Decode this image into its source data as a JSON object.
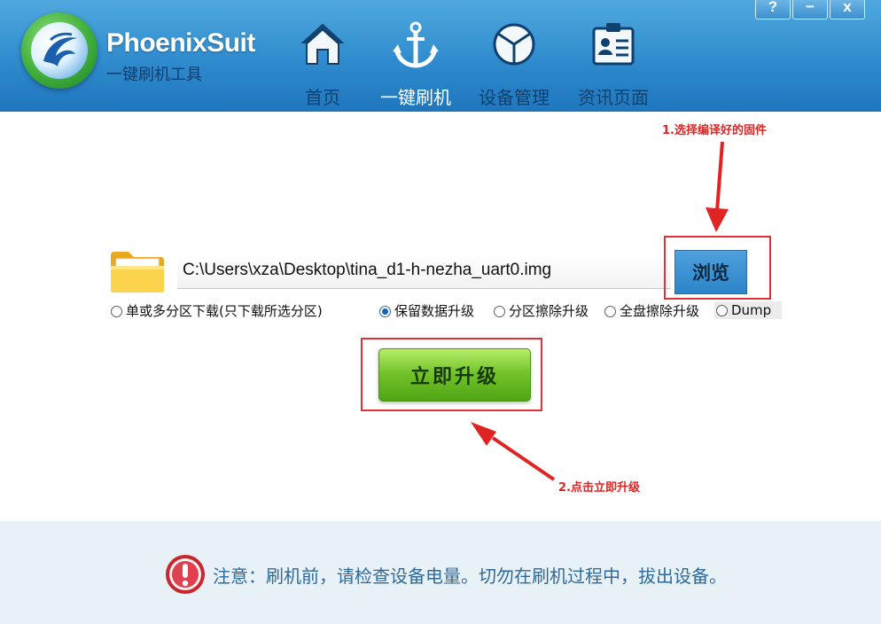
{
  "header": {
    "app_name": "PhoenixSuit",
    "app_subtitle": "一键刷机工具",
    "nav": [
      {
        "label": "首页",
        "icon": "home-icon"
      },
      {
        "label": "一键刷机",
        "icon": "anchor-icon",
        "active": true
      },
      {
        "label": "设备管理",
        "icon": "device-manage-icon"
      },
      {
        "label": "资讯页面",
        "icon": "news-icon"
      }
    ],
    "window_buttons": {
      "help": "?",
      "minimize": "−",
      "close": "x"
    }
  },
  "main": {
    "firmware_path": "C:\\Users\\xza\\Desktop\\tina_d1-h-nezha_uart0.img",
    "browse_label": "浏览",
    "options": [
      {
        "label": "单或多分区下载(只下载所选分区)",
        "checked": false
      },
      {
        "label": "保留数据升级",
        "checked": true
      },
      {
        "label": "分区擦除升级",
        "checked": false
      },
      {
        "label": "全盘擦除升级",
        "checked": false
      },
      {
        "label": "Dump",
        "checked": false
      }
    ],
    "upgrade_label": "立即升级"
  },
  "annotations": {
    "step1": "1.选择编译好的固件",
    "step2": "2.点击立即升级",
    "color": "#e02424"
  },
  "footer": {
    "warning": "注意：刷机前，请检查设备电量。切勿在刷机过程中，拔出设备。"
  },
  "colors": {
    "header": "#2f8bcd",
    "browse_button": "#2b84c8",
    "upgrade_button": "#74c42b",
    "footer": "#e8f1f6"
  }
}
